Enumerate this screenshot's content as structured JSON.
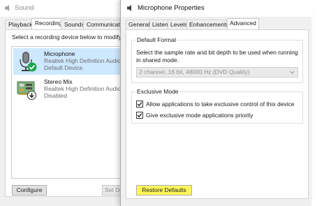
{
  "sound": {
    "title": "Sound",
    "tabs": [
      {
        "label": "Playback"
      },
      {
        "label": "Recording"
      },
      {
        "label": "Sounds"
      },
      {
        "label": "Communication"
      }
    ],
    "active_tab": "Recording",
    "instruction": "Select a recording device below to modify its settings:",
    "devices": [
      {
        "name": "Microphone",
        "line1": "Realtek High Definition Audio",
        "line2": "Default Device",
        "icon": "microphone-icon",
        "status_icon": "default-check-icon",
        "selected": true
      },
      {
        "name": "Stereo Mix",
        "line1": "Realtek High Definition Audio",
        "line2": "Disabled",
        "icon": "circuit-board-icon",
        "status_icon": "disabled-arrow-icon",
        "selected": false
      }
    ],
    "configure_label": "Configure",
    "set_default_label": "Set Default"
  },
  "props": {
    "title": "Microphone Properties",
    "tabs": [
      {
        "label": "General"
      },
      {
        "label": "Listen"
      },
      {
        "label": "Levels"
      },
      {
        "label": "Enhancements"
      },
      {
        "label": "Advanced"
      }
    ],
    "active_tab": "Advanced",
    "default_format": {
      "group_label": "Default Format",
      "description": "Select the sample rate and bit depth to be used when running in shared mode.",
      "selected_value": "2 channel, 16 bit, 48000 Hz (DVD Quality)"
    },
    "exclusive_mode": {
      "group_label": "Exclusive Mode",
      "options": [
        {
          "label": "Allow applications to take exclusive control of this device",
          "checked": true
        },
        {
          "label": "Give exclusive mode applications priority",
          "checked": true
        }
      ]
    },
    "restore_label": "Restore Defaults"
  },
  "colors": {
    "highlight": "#fff65a",
    "selection": "#cde8ff",
    "default_badge": "#1ea54c"
  }
}
